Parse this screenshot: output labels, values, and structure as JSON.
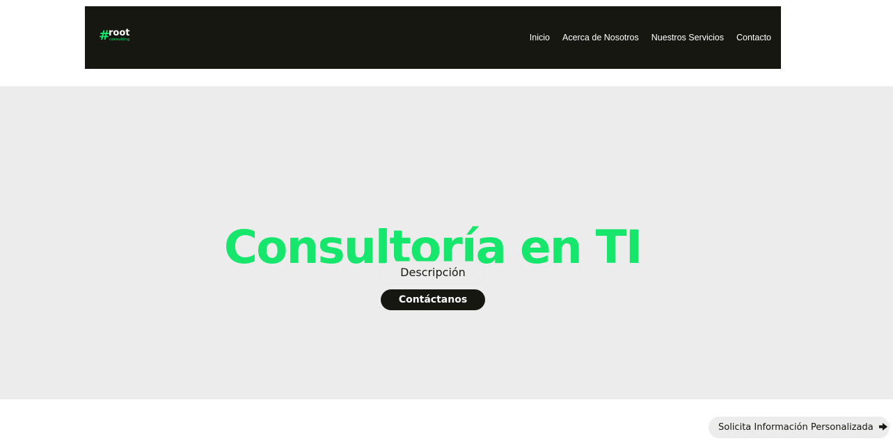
{
  "header": {
    "logo": {
      "symbol": "#",
      "word": "root",
      "sub": "consulting"
    },
    "nav": [
      {
        "label": "Inicio"
      },
      {
        "label": "Acerca de Nosotros"
      },
      {
        "label": "Nuestros Servicios"
      },
      {
        "label": "Contacto"
      }
    ]
  },
  "hero": {
    "title": "Consultoría en TI",
    "description_label": "Descripción",
    "cta_label": "Contáctanos"
  },
  "floating": {
    "info_label": "Solicita Información Personalizada",
    "icon": "arrow-right-icon"
  },
  "colors": {
    "brand_green": "#16e66b",
    "dark": "#161711",
    "hero_bg": "#ececec"
  }
}
